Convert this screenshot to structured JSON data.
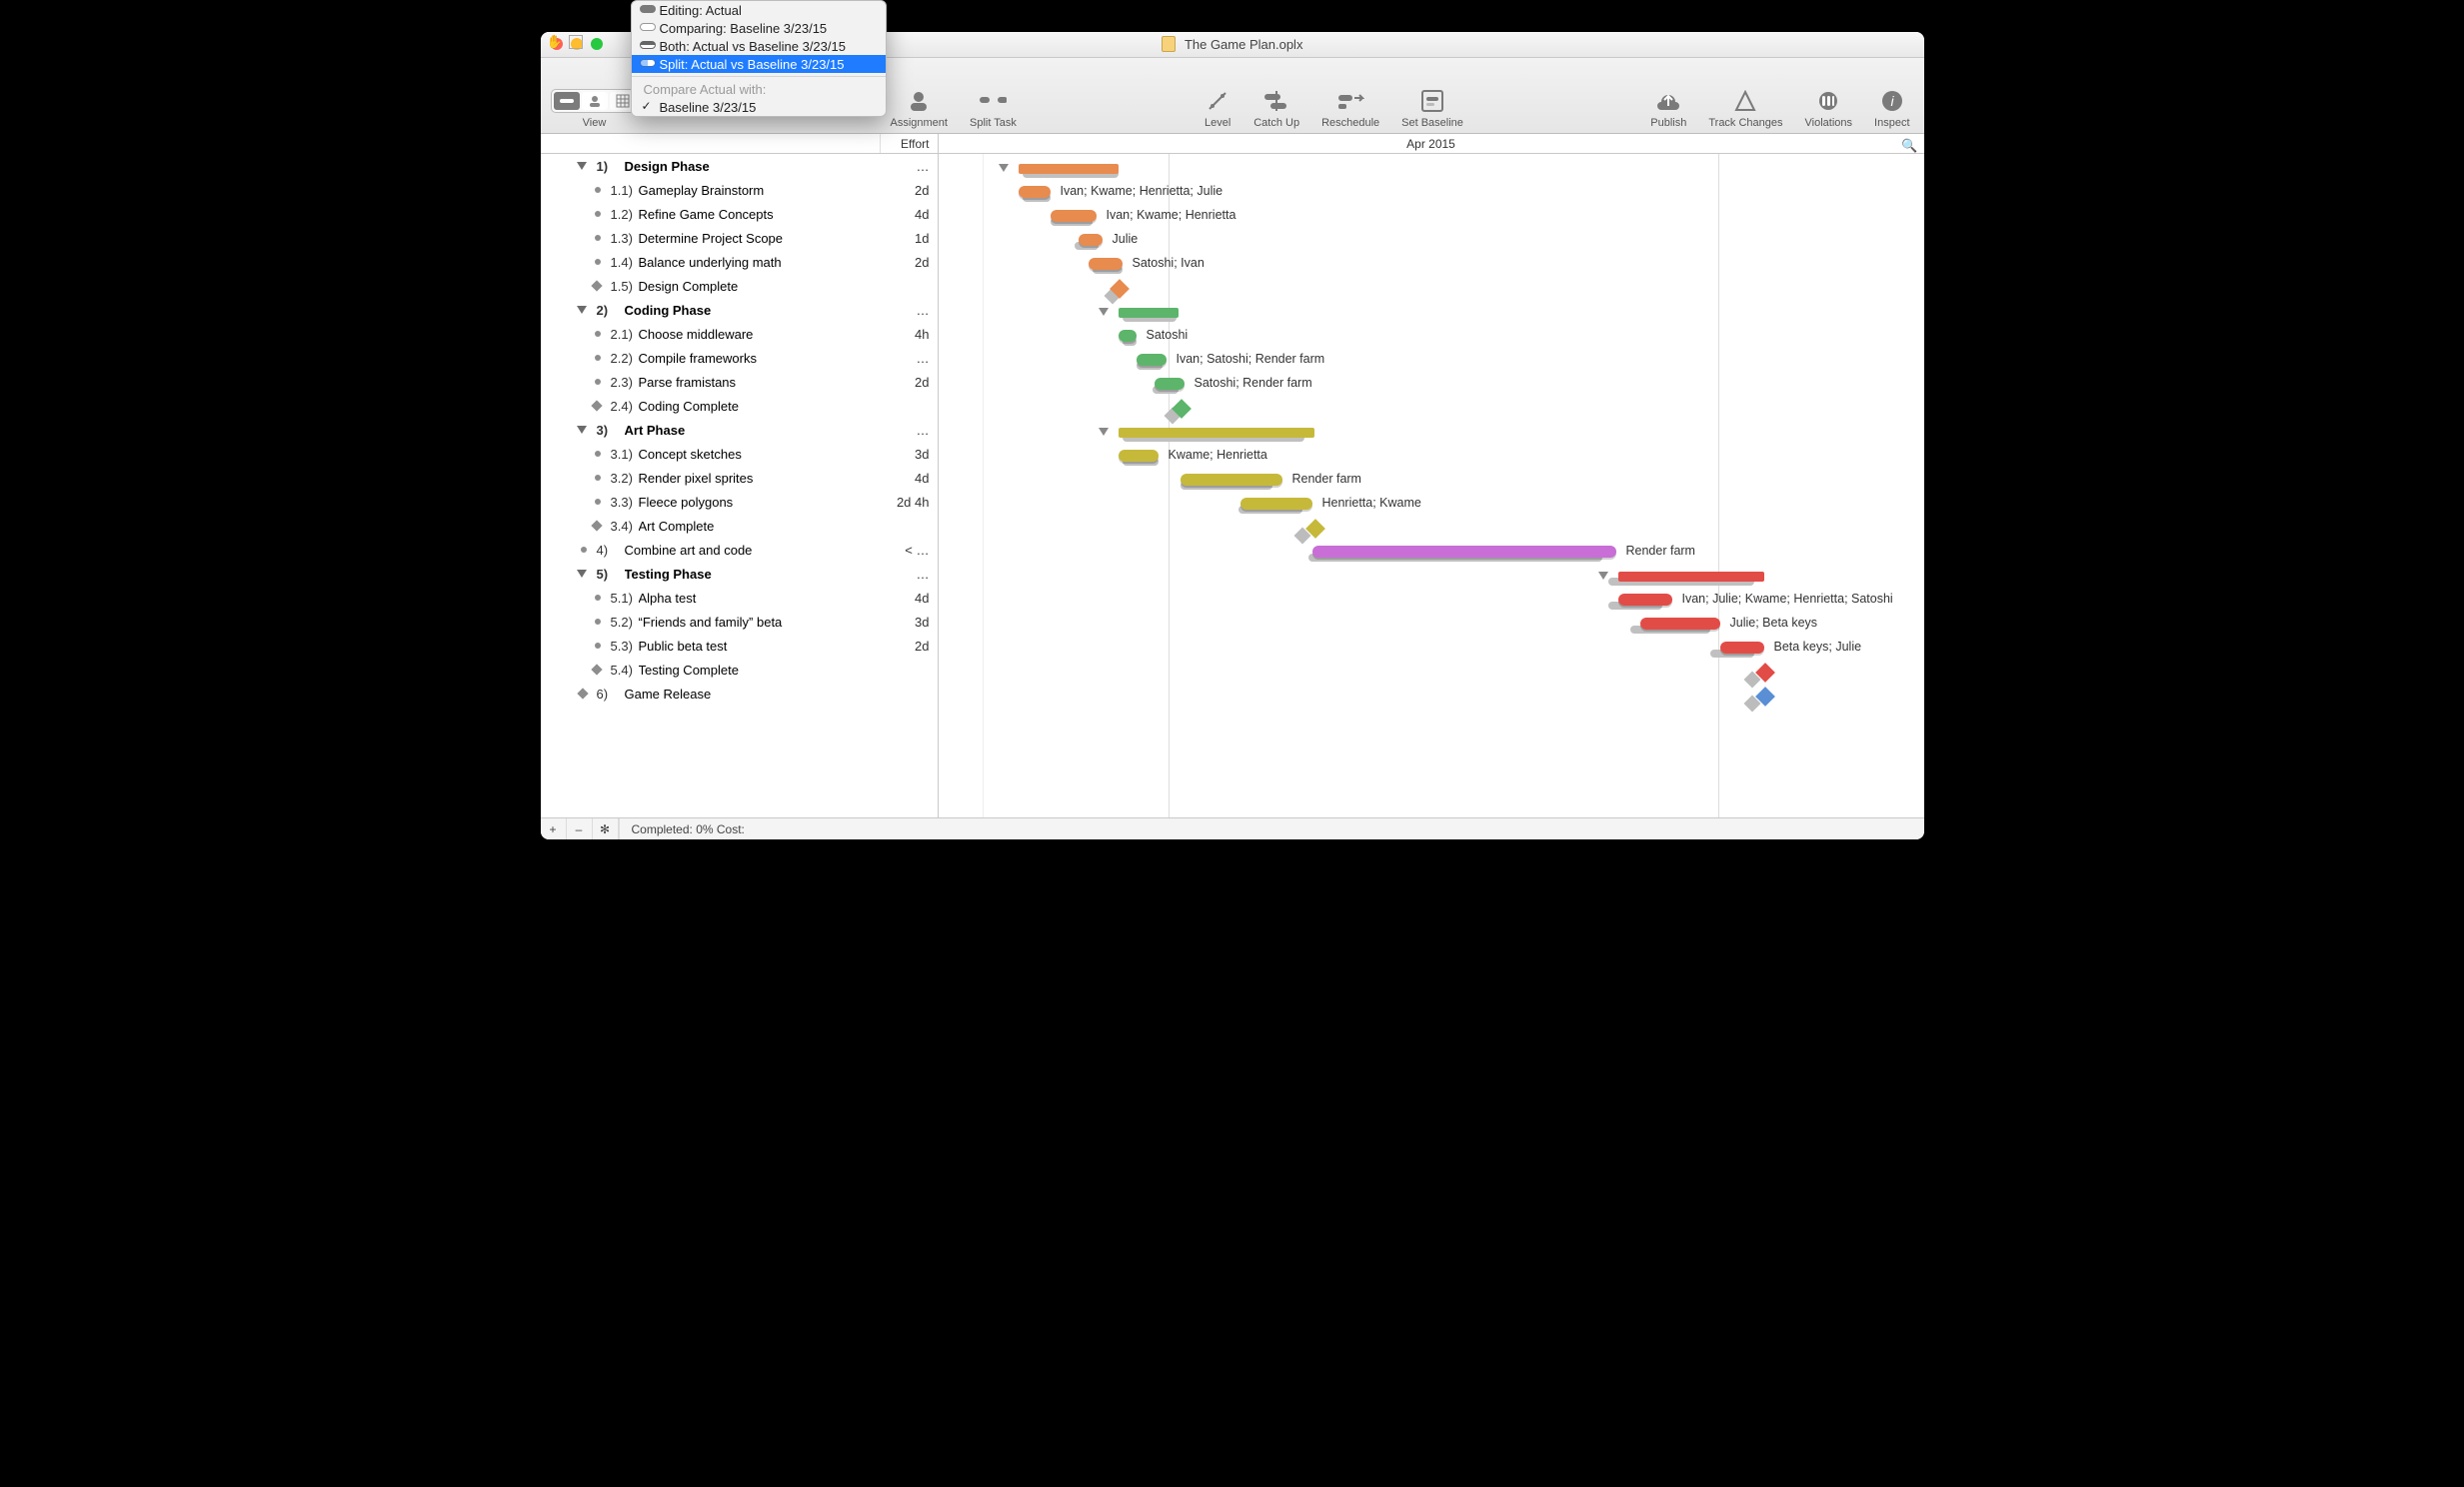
{
  "window": {
    "title": "The Game Plan.oplx"
  },
  "toolbar": {
    "view": "View",
    "assignment": "Assignment",
    "split_task": "Split Task",
    "level": "Level",
    "catch_up": "Catch Up",
    "reschedule": "Reschedule",
    "set_baseline": "Set Baseline",
    "publish": "Publish",
    "track_changes": "Track Changes",
    "violations": "Violations",
    "inspect": "Inspect"
  },
  "columns": {
    "effort": "Effort",
    "month": "Apr 2015"
  },
  "menu": {
    "editing": "Editing: Actual",
    "comparing": "Comparing: Baseline 3/23/15",
    "both": "Both: Actual vs Baseline 3/23/15",
    "split": "Split: Actual vs Baseline 3/23/15",
    "compare_header": "Compare Actual with:",
    "baseline_item": "Baseline 3/23/15"
  },
  "bottom": {
    "plus": "+",
    "minus": "–",
    "gear": "✻",
    "status": "Completed: 0% Cost:"
  },
  "tasks": [
    {
      "id": "1",
      "num": "1)",
      "name": "Design Phase",
      "eff": "…",
      "type": "phase"
    },
    {
      "id": "1.1",
      "num": "1.1)",
      "name": "Gameplay Brainstorm",
      "eff": "2d",
      "type": "task"
    },
    {
      "id": "1.2",
      "num": "1.2)",
      "name": "Refine Game Concepts",
      "eff": "4d",
      "type": "task"
    },
    {
      "id": "1.3",
      "num": "1.3)",
      "name": "Determine Project Scope",
      "eff": "1d",
      "type": "task"
    },
    {
      "id": "1.4",
      "num": "1.4)",
      "name": "Balance underlying math",
      "eff": "2d",
      "type": "task"
    },
    {
      "id": "1.5",
      "num": "1.5)",
      "name": "Design Complete",
      "eff": "",
      "type": "milestone"
    },
    {
      "id": "2",
      "num": "2)",
      "name": "Coding Phase",
      "eff": "…",
      "type": "phase"
    },
    {
      "id": "2.1",
      "num": "2.1)",
      "name": "Choose middleware",
      "eff": "4h",
      "type": "task"
    },
    {
      "id": "2.2",
      "num": "2.2)",
      "name": "Compile frameworks",
      "eff": "…",
      "type": "task"
    },
    {
      "id": "2.3",
      "num": "2.3)",
      "name": "Parse framistans",
      "eff": "2d",
      "type": "task"
    },
    {
      "id": "2.4",
      "num": "2.4)",
      "name": "Coding Complete",
      "eff": "",
      "type": "milestone"
    },
    {
      "id": "3",
      "num": "3)",
      "name": "Art Phase",
      "eff": "…",
      "type": "phase"
    },
    {
      "id": "3.1",
      "num": "3.1)",
      "name": "Concept sketches",
      "eff": "3d",
      "type": "task"
    },
    {
      "id": "3.2",
      "num": "3.2)",
      "name": "Render pixel sprites",
      "eff": "4d",
      "type": "task"
    },
    {
      "id": "3.3",
      "num": "3.3)",
      "name": "Fleece polygons",
      "eff": "2d 4h",
      "type": "task"
    },
    {
      "id": "3.4",
      "num": "3.4)",
      "name": "Art Complete",
      "eff": "",
      "type": "milestone"
    },
    {
      "id": "4",
      "num": "4)",
      "name": "Combine art and code",
      "eff": "< …",
      "type": "task-top"
    },
    {
      "id": "5",
      "num": "5)",
      "name": "Testing Phase",
      "eff": "…",
      "type": "phase"
    },
    {
      "id": "5.1",
      "num": "5.1)",
      "name": "Alpha test",
      "eff": "4d",
      "type": "task"
    },
    {
      "id": "5.2",
      "num": "5.2)",
      "name": "“Friends and family” beta",
      "eff": "3d",
      "type": "task"
    },
    {
      "id": "5.3",
      "num": "5.3)",
      "name": "Public beta test",
      "eff": "2d",
      "type": "task"
    },
    {
      "id": "5.4",
      "num": "5.4)",
      "name": "Testing Complete",
      "eff": "",
      "type": "milestone"
    },
    {
      "id": "6",
      "num": "6)",
      "name": "Game Release",
      "eff": "",
      "type": "milestone-top"
    }
  ],
  "gantt_labels": {
    "r1": "Ivan; Kwame; Henrietta; Julie",
    "r2": "Ivan; Kwame; Henrietta",
    "r3": "Julie",
    "r4": "Satoshi; Ivan",
    "r7": "Satoshi",
    "r8": "Ivan; Satoshi; Render farm",
    "r9": "Satoshi; Render farm",
    "r12": "Kwame; Henrietta",
    "r13": "Render farm",
    "r14": "Henrietta; Kwame",
    "r16": "Render farm",
    "r18": "Ivan; Julie; Kwame; Henrietta; Satoshi",
    "r19": "Julie; Beta keys",
    "r20": "Beta keys; Julie"
  },
  "colors": {
    "orange": "#e88b4f",
    "green": "#5cb56a",
    "olive": "#c6b93a",
    "purple": "#c86ed6",
    "red": "#e24c47",
    "blue": "#5a8fd6",
    "gray": "#bdbdbd"
  }
}
